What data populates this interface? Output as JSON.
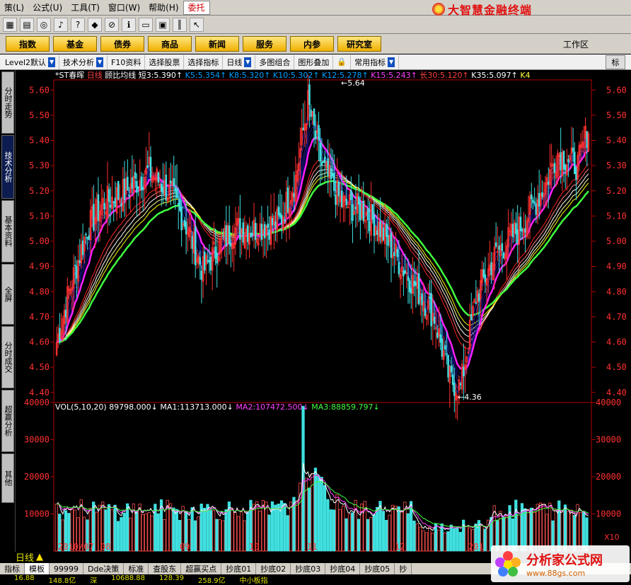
{
  "menu": {
    "items": [
      "策(L)",
      "公式(U)",
      "工具(T)",
      "窗口(W)",
      "帮助(H)",
      "委托"
    ],
    "active": "委托"
  },
  "brand": {
    "title": "大智慧金融终端"
  },
  "nav": {
    "buttons": [
      "指数",
      "基金",
      "债券",
      "商品",
      "新闻",
      "服务",
      "内参",
      "研究室"
    ],
    "workzone": "工作区"
  },
  "toolbar": {
    "items": [
      "Level2默认",
      "技术分析",
      "F10资料",
      "选择股票",
      "选择指标",
      "日线",
      "多图组合",
      "图形叠加",
      "常用指标"
    ],
    "right_tab": "标"
  },
  "sidebar": {
    "tabs": [
      "分时走势",
      "技术分析",
      "基本资料",
      "全屏",
      "分时成交",
      "超赢分析",
      "其他"
    ],
    "active": "技术分析"
  },
  "chart_header": {
    "stock": "*ST春晖",
    "period": "日线",
    "indicator": "顾比均线",
    "values": [
      {
        "label": "短3:",
        "value": "5.390",
        "color": "#ffffff"
      },
      {
        "label": "K5:",
        "value": "5.354",
        "color": "#00a0ff"
      },
      {
        "label": "K8:",
        "value": "5.320",
        "color": "#00a0ff"
      },
      {
        "label": "K10:",
        "value": "5.302",
        "color": "#00a0ff"
      },
      {
        "label": "K12:",
        "value": "5.278",
        "color": "#00a0ff"
      },
      {
        "label": "K15:",
        "value": "5.243",
        "color": "#ff40ff"
      },
      {
        "label": "长30:",
        "value": "5.120",
        "color": "#ff4040"
      },
      {
        "label": "K35:",
        "value": "5.097",
        "color": "#ffffff"
      },
      {
        "label": "K4",
        "value": "",
        "color": "#ffff40"
      }
    ]
  },
  "vol_header": {
    "label": "VOL(5,10,20)",
    "values": [
      {
        "label": "",
        "value": "89798.000",
        "color": "#ffffff"
      },
      {
        "label": "MA1:",
        "value": "113713.000",
        "color": "#ffffff"
      },
      {
        "label": "MA2:",
        "value": "107472.500",
        "color": "#ff40ff"
      },
      {
        "label": "MA3:",
        "value": "88859.797",
        "color": "#40ff40"
      }
    ]
  },
  "chart_data": {
    "type": "candlestick",
    "price_axis": [
      "5.60",
      "5.50",
      "5.40",
      "5.30",
      "5.20",
      "5.10",
      "5.00",
      "4.90",
      "4.80",
      "4.70",
      "4.60",
      "4.50",
      "4.40"
    ],
    "ylim": [
      4.36,
      5.64
    ],
    "vol_axis": [
      "40000",
      "30000",
      "20000",
      "10000"
    ],
    "vol_ylim": [
      0,
      40000
    ],
    "x_axis_labels": [
      "2010/07",
      "08",
      "09",
      "10",
      "11",
      "12",
      "201"
    ],
    "annotations": [
      {
        "text": "5.64",
        "kind": "high"
      },
      {
        "text": "4.36",
        "kind": "low"
      }
    ],
    "multiplier": "X10"
  },
  "bottom": {
    "period_label": "日线",
    "tabs": [
      "指标",
      "模板",
      "99999",
      "Dde决策",
      "标准",
      "查股东",
      "超赢买点",
      "抄底01",
      "抄底02",
      "抄底03",
      "抄底04",
      "抄底05",
      "抄"
    ],
    "status": [
      "16.88",
      "148.8亿",
      "深",
      "10688.88",
      "128.39",
      "258.9亿",
      "中小板指"
    ]
  },
  "watermark": {
    "title": "分析家公式网",
    "url": "www.88gs.com"
  }
}
